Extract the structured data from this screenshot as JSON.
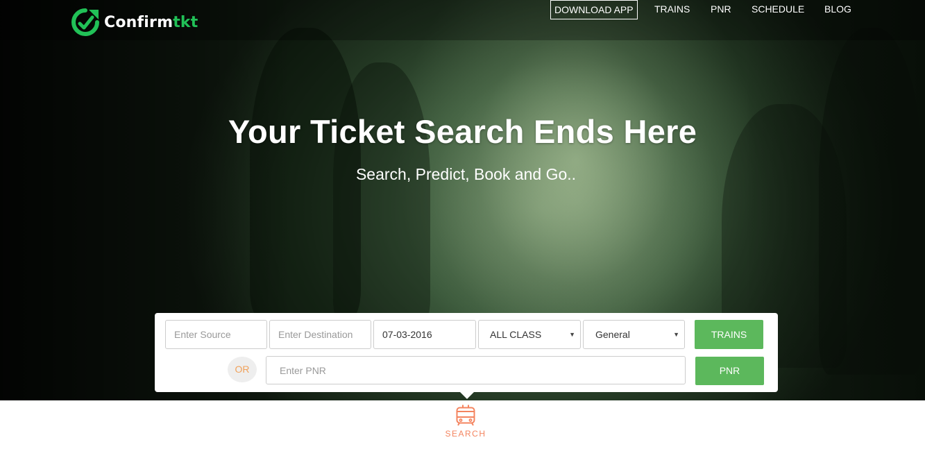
{
  "brand": {
    "logo_part1": "Confirm",
    "logo_part2": "tkt",
    "accent_color": "#21c157"
  },
  "nav": {
    "items": [
      {
        "label": "DOWNLOAD APP",
        "style": "outlined"
      },
      {
        "label": "TRAINS"
      },
      {
        "label": "PNR"
      },
      {
        "label": "SCHEDULE"
      },
      {
        "label": "BLOG"
      }
    ]
  },
  "hero": {
    "title": "Your Ticket Search Ends Here",
    "subtitle": "Search, Predict, Book and Go.."
  },
  "search": {
    "source_placeholder": "Enter Source",
    "destination_placeholder": "Enter Destination",
    "date_value": "07-03-2016",
    "class_select": "ALL CLASS",
    "quota_select": "General",
    "trains_button": "TRAINS",
    "or_label": "OR",
    "pnr_placeholder": "Enter PNR",
    "pnr_button": "PNR",
    "button_color": "#5cb85c"
  },
  "tabs": {
    "active_tab": "SEARCH",
    "icon": "train-icon",
    "active_color": "#f4845f"
  }
}
